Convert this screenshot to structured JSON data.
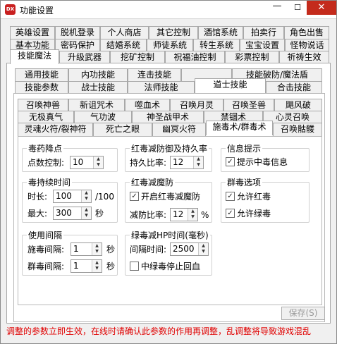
{
  "window": {
    "title": "功能设置",
    "icon": "DX"
  },
  "tabs_row1": [
    "英雄设置",
    "脱机登录",
    "个人商店",
    "其它控制",
    "酒馆系统",
    "拍卖行",
    "角色出售"
  ],
  "tabs_row2": [
    "基本功能",
    "密码保护",
    "结婚系统",
    "师徒系统",
    "转生系统",
    "宝宝设置",
    "怪物说话"
  ],
  "tabs_row3": [
    "技能魔法",
    "升级武器",
    "挖矿控制",
    "祝福油控制",
    "彩票控制",
    "祈祷生效"
  ],
  "subtabs_row1": [
    "通用技能",
    "内功技能",
    "连击技能",
    "技能破防/魔法盾"
  ],
  "subtabs_row2": [
    "技能参数",
    "战士技能",
    "法师技能",
    "道士技能",
    "合击技能"
  ],
  "skilltabs_row1": [
    "召唤神兽",
    "新诅咒术",
    "噬血术",
    "召唤月灵",
    "召唤圣兽",
    "飓风破"
  ],
  "skilltabs_row2": [
    "无极真气",
    "气功波",
    "神圣战甲术",
    "禁锢术",
    "心灵召唤"
  ],
  "skilltabs_row3": [
    "灵魂火符/裂神符",
    "死亡之眼",
    "幽冥火符",
    "施毒术/群毒术",
    "召唤骷髅"
  ],
  "poison_drop": {
    "title": "毒药降点",
    "points_label": "点数控制:",
    "points_value": "10"
  },
  "red_defense": {
    "title": "红毒减防御及持久率",
    "rate_label": "持久比率:",
    "rate_value": "12"
  },
  "info": {
    "title": "信息提示",
    "poison_msg_label": "提示中毒信息",
    "poison_msg_checked": true
  },
  "poison_duration": {
    "title": "毒持续时间",
    "time_label": "时长:",
    "time_value": "100",
    "time_unit": "/100",
    "max_label": "最大:",
    "max_value": "300",
    "max_unit": "秒"
  },
  "red_reduce": {
    "title": "红毒减魔防",
    "enable_label": "开启红毒减魔防",
    "enable_checked": true,
    "rate_label": "减防比率:",
    "rate_value": "12",
    "rate_unit": "%"
  },
  "poison_options": {
    "title": "群毒选项",
    "allow_red_label": "允许红毒",
    "allow_red_checked": true,
    "allow_green_label": "允许绿毒",
    "allow_green_checked": true
  },
  "use_interval": {
    "title": "使用间隔",
    "cast_label": "施毒间隔:",
    "cast_value": "1",
    "mass_label": "群毒间隔:",
    "mass_value": "1",
    "unit": "秒"
  },
  "green_hp": {
    "title": "绿毒减HP时间(毫秒)",
    "interval_label": "间隔时间:",
    "interval_value": "2500",
    "stop_label": "中绿毒停止回血",
    "stop_checked": false
  },
  "save_label": "保存(S)",
  "status_text": "调整的参数立即生效，在线时请确认此参数的作用再调整，乱调整将导致游戏混乱"
}
